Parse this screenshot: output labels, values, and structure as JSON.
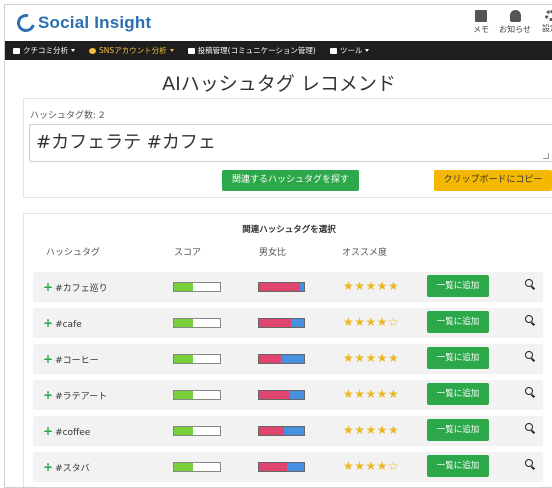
{
  "app": {
    "logo_text": "Social Insight"
  },
  "header": {
    "memo_label": "メモ",
    "notice_label": "お知らせ",
    "settings_label": "設定"
  },
  "nav": [
    {
      "label": "クチコミ分析",
      "icon": "megaphone-icon",
      "active": false
    },
    {
      "label": "SNSアカウント分析",
      "icon": "user-circle-icon",
      "active": true
    },
    {
      "label": "投稿管理(コミュニケーション管理)",
      "icon": "chat-icon",
      "active": false
    },
    {
      "label": "ツール",
      "icon": "briefcase-icon",
      "active": false
    }
  ],
  "page": {
    "title": "AIハッシュタグ レコメンド"
  },
  "input": {
    "count_label": "ハッシュタグ数: 2",
    "value": "#カフェラテ #カフェ"
  },
  "buttons": {
    "search": "関連するハッシュタグを探す",
    "copy": "クリップボードにコピー"
  },
  "related": {
    "title": "関連ハッシュタグを選択",
    "columns": [
      "ハッシュタグ",
      "スコア",
      "男女比",
      "オススメ度"
    ],
    "add_label": "一覧に追加",
    "rows": [
      {
        "tag": "#カフェ巡り",
        "score": 0.42,
        "female_ratio": 0.92,
        "stars": "★★★★★"
      },
      {
        "tag": "#cafe",
        "score": 0.42,
        "female_ratio": 0.72,
        "stars": "★★★★☆"
      },
      {
        "tag": "#コーヒー",
        "score": 0.42,
        "female_ratio": 0.48,
        "stars": "★★★★★"
      },
      {
        "tag": "#ラテアート",
        "score": 0.42,
        "female_ratio": 0.68,
        "stars": "★★★★★"
      },
      {
        "tag": "#coffee",
        "score": 0.42,
        "female_ratio": 0.55,
        "stars": "★★★★★"
      },
      {
        "tag": "#スタバ",
        "score": 0.42,
        "female_ratio": 0.62,
        "stars": "★★★★☆"
      }
    ]
  },
  "colors": {
    "brand": "#2b6fb2",
    "green": "#2ca74a",
    "yellow": "#f5b800",
    "female": "#e0456f",
    "male": "#4a90e2",
    "score": "#78d03a",
    "star": "#e8b923"
  }
}
